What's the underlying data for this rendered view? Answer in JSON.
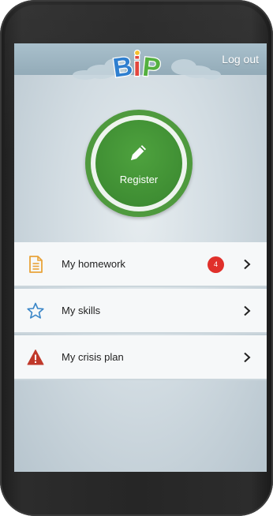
{
  "app": {
    "logo_text": "BiP"
  },
  "header": {
    "logout_label": "Log out"
  },
  "register": {
    "label": "Register"
  },
  "menu": {
    "items": [
      {
        "label": "My homework",
        "icon": "document-icon",
        "badge": "4"
      },
      {
        "label": "My skills",
        "icon": "star-icon"
      },
      {
        "label": "My crisis plan",
        "icon": "warning-icon"
      }
    ]
  },
  "colors": {
    "register_green": "#3f8e33",
    "badge_red": "#e0302b",
    "warning_red": "#c0392b",
    "document_orange": "#e8a33a",
    "star_blue": "#3a86c8",
    "top_bar": "#a9c0cc"
  }
}
